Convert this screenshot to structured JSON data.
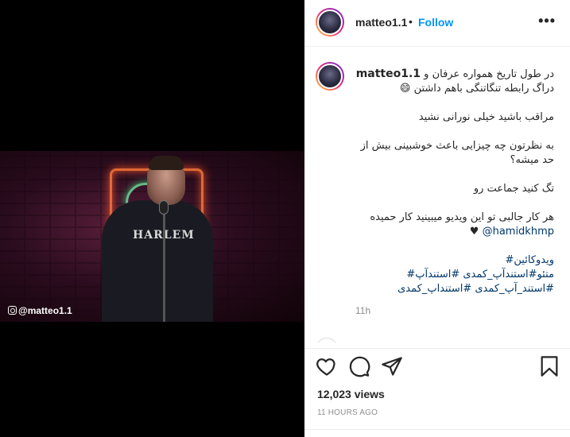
{
  "post": {
    "username": "matteo1.1",
    "follow_label": "Follow",
    "separator": "•",
    "more_label": "•••"
  },
  "media": {
    "watermark": "@matteo1.1",
    "shirt_text": "HARLEM"
  },
  "caption": {
    "username": "matteo1.1",
    "line1": "در طول تاریخ همواره عرفان و",
    "line2": "دراگ رابطه تنگاتنگی باهم داشتن 😄",
    "p2": "مراقب باشید خیلی نورانی نشید",
    "p3": "به نظرتون چه چیزایی باعث خوشبینی بیش از حد میشه؟",
    "p4": "تگ کنید جماعت رو",
    "p5_text": "هر کار جالبی تو این ویدیو میبینید کار حمیده",
    "p5_heart": "♥",
    "p5_mention": "@hamidkhmp",
    "tags_line1": "ویدوکائین#",
    "tags_line2": "متئو#استندآپ_کمدی #استندآپ#",
    "tags_line3": "#استند_آپ_کمدی #استنداپ_کمدی",
    "time": "11h"
  },
  "actions": {
    "like": "heart-icon",
    "comment": "comment-icon",
    "share": "share-icon",
    "save": "bookmark-icon"
  },
  "stats": {
    "views": "12,023 views",
    "posted": "11 HOURS AGO"
  }
}
